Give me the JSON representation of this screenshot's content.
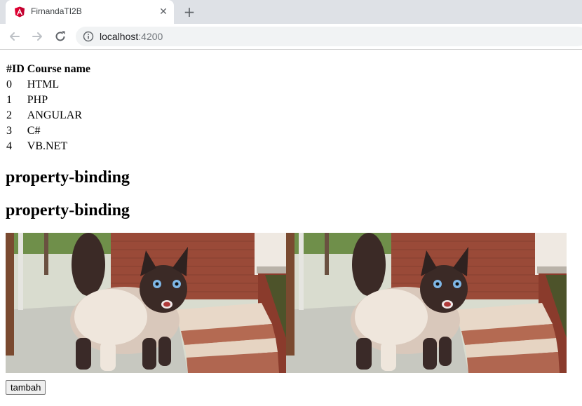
{
  "browser": {
    "tab_title": "FirnandaTI2B",
    "url_host": "localhost",
    "url_port": ":4200",
    "accent": "#dd0031"
  },
  "courses": {
    "headers": [
      "#ID",
      "Course name"
    ],
    "rows": [
      [
        "0",
        "HTML"
      ],
      [
        "1",
        "PHP"
      ],
      [
        "2",
        "ANGULAR"
      ],
      [
        "3",
        "C#"
      ],
      [
        "4",
        "VB.NET"
      ]
    ]
  },
  "headings": [
    "property-binding",
    "property-binding"
  ],
  "images": [
    {
      "subject": "siamese-cat-photo"
    },
    {
      "subject": "siamese-cat-photo"
    }
  ],
  "button": {
    "label": "tambah"
  }
}
